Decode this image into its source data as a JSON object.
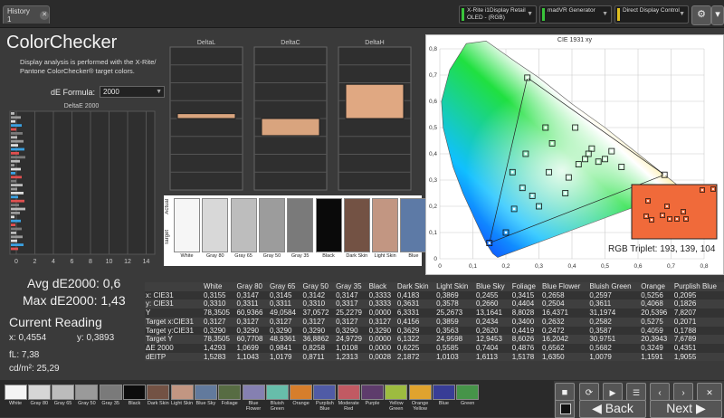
{
  "tab": {
    "label": "History 1"
  },
  "devices": [
    {
      "label": "X-Rite i1Display Retail OLED - (RGB)",
      "color": "#39c43a"
    },
    {
      "label": "madVR Generator",
      "color": "#39c43a"
    },
    {
      "label": "Direct Display Control",
      "color": "#e0c020"
    }
  ],
  "title": "ColorChecker",
  "description": "Display analysis is performed with the X-Rite/ Pantone ColorChecker® target colors.",
  "formula": {
    "label": "dE Formula:",
    "value": "2000"
  },
  "histogram": {
    "title": "DeltaE 2000",
    "ticks": [
      "0",
      "2",
      "4",
      "6",
      "8",
      "10",
      "12",
      "14"
    ]
  },
  "delta_charts": [
    {
      "title": "DeltaL",
      "value": 0.2,
      "color": "#d9a47e"
    },
    {
      "title": "DeltaC",
      "value": -0.7,
      "color": "#d9a47e"
    },
    {
      "title": "DeltaH",
      "value": 1.4,
      "color": "#e0a882"
    }
  ],
  "patch_strip": {
    "actual_label": "Actual",
    "target_label": "Target",
    "patches": [
      {
        "label": "White",
        "color": "#f6f6f6"
      },
      {
        "label": "Gray 80",
        "color": "#d8d8d8"
      },
      {
        "label": "Gray 65",
        "color": "#bdbdbd"
      },
      {
        "label": "Gray 50",
        "color": "#9c9c9c"
      },
      {
        "label": "Gray 35",
        "color": "#7a7a7a"
      },
      {
        "label": "Black",
        "color": "#0a0a0a"
      },
      {
        "label": "Dark Skin",
        "color": "#735244"
      },
      {
        "label": "Light Skin",
        "color": "#c29682"
      },
      {
        "label": "Blue",
        "color": "#5d7aa6"
      }
    ]
  },
  "cie": {
    "title": "CIE 1931 xy",
    "ticks": [
      "0",
      "0,1",
      "0,2",
      "0,3",
      "0,4",
      "0,5",
      "0,6",
      "0,7",
      "0,8"
    ],
    "rgb_triplet": "RGB Triplet: 193, 139, 104"
  },
  "stats": {
    "avg": "Avg dE2000: 0,6",
    "max": "Max dE2000: 1,43",
    "reading_title": "Current Reading",
    "x": "x: 0,4554",
    "y": "y: 0,3893",
    "fl": "fL: 7,38",
    "cdm2": "cd/m²: 25,29"
  },
  "table": {
    "headers": [
      "",
      "White",
      "Gray 80",
      "Gray 65",
      "Gray 50",
      "Gray 35",
      "Black",
      "Dark Skin",
      "Light Skin",
      "Blue Sky",
      "Foliage",
      "Blue Flower",
      "Bluish Green",
      "Orange",
      "Purplish Blue"
    ],
    "rows": [
      [
        "x: CIE31",
        "0,3155",
        "0,3147",
        "0,3145",
        "0,3142",
        "0,3147",
        "0,3333",
        "0,4183",
        "0,3869",
        "0,2455",
        "0,3415",
        "0,2658",
        "0,2597",
        "0,5256",
        "0,2095"
      ],
      [
        "y: CIE31",
        "0,3310",
        "0,3311",
        "0,3311",
        "0,3310",
        "0,3317",
        "0,3333",
        "0,3631",
        "0,3578",
        "0,2660",
        "0,4404",
        "0,2504",
        "0,3611",
        "0,4068",
        "0,1826"
      ],
      [
        "Y",
        "78,3505",
        "60,9366",
        "49,0584",
        "37,0572",
        "25,2279",
        "0,0000",
        "6,3331",
        "25,2673",
        "13,1641",
        "8,8028",
        "16,4371",
        "31,1974",
        "20,5396",
        "7,8207"
      ],
      [
        "Target x:CIE31",
        "0,3127",
        "0,3127",
        "0,3127",
        "0,3127",
        "0,3127",
        "0,3127",
        "0,4156",
        "0,3859",
        "0,2434",
        "0,3400",
        "0,2632",
        "0,2582",
        "0,5275",
        "0,2071"
      ],
      [
        "Target y:CIE31",
        "0,3290",
        "0,3290",
        "0,3290",
        "0,3290",
        "0,3290",
        "0,3290",
        "0,3629",
        "0,3563",
        "0,2620",
        "0,4419",
        "0,2472",
        "0,3587",
        "0,4059",
        "0,1788"
      ],
      [
        "Target Y",
        "78,3505",
        "60,7708",
        "48,9361",
        "36,8862",
        "24,9729",
        "0,0000",
        "6,1322",
        "24,9598",
        "12,9453",
        "8,6026",
        "16,2042",
        "30,9751",
        "20,3943",
        "7,6789"
      ],
      [
        "ΔE 2000",
        "1,4293",
        "1,0699",
        "0,9841",
        "0,8258",
        "1,0108",
        "0,0000",
        "0,6225",
        "0,5585",
        "0,7404",
        "0,4876",
        "0,6562",
        "0,5682",
        "0,3249",
        "0,4351"
      ],
      [
        "dEITP",
        "1,5283",
        "1,1043",
        "1,0179",
        "0,8711",
        "1,2313",
        "0,0028",
        "2,1872",
        "1,0103",
        "1,6113",
        "1,5178",
        "1,6350",
        "1,0079",
        "1,1591",
        "1,9055"
      ]
    ]
  },
  "swatches": [
    {
      "label": "White",
      "color": "#f4f4f4"
    },
    {
      "label": "Gray 80",
      "color": "#d6d6d6"
    },
    {
      "label": "Gray 65",
      "color": "#bcbcbc"
    },
    {
      "label": "Gray 50",
      "color": "#9a9a9a"
    },
    {
      "label": "Gray 35",
      "color": "#7a7a7a"
    },
    {
      "label": "Black",
      "color": "#0c0c0c"
    },
    {
      "label": "Dark Skin",
      "color": "#735244"
    },
    {
      "label": "Light Skin",
      "color": "#c29682"
    },
    {
      "label": "Blue Sky",
      "color": "#627a9d"
    },
    {
      "label": "Foliage",
      "color": "#576c43"
    },
    {
      "label": "Blue Flower",
      "color": "#8580b1"
    },
    {
      "label": "Bluish Green",
      "color": "#67bdaa"
    },
    {
      "label": "Orange",
      "color": "#d67e2c"
    },
    {
      "label": "Purplish Blue",
      "color": "#505ba6"
    },
    {
      "label": "Moderate Red",
      "color": "#c15a63"
    },
    {
      "label": "Purple",
      "color": "#5e3c6c"
    },
    {
      "label": "Yellow Green",
      "color": "#9dbc40"
    },
    {
      "label": "Orange Yellow",
      "color": "#e0a32e"
    },
    {
      "label": "Blue",
      "color": "#383d96"
    },
    {
      "label": "Green",
      "color": "#469449"
    }
  ],
  "nav": {
    "back": "Back",
    "next": "Next"
  }
}
